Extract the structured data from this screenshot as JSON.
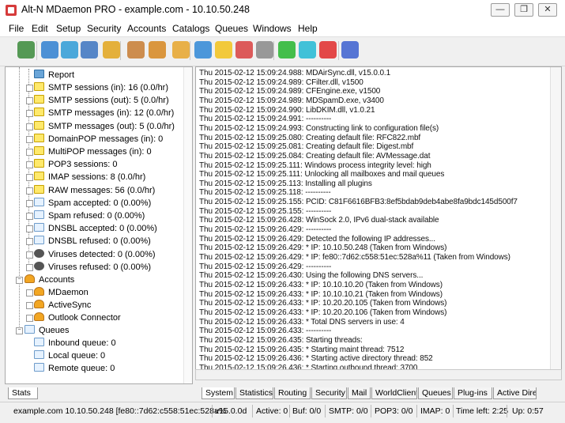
{
  "window": {
    "title": "Alt-N MDaemon PRO - example.com - 10.10.50.248",
    "minimize_glyph": "—",
    "restore_glyph": "❐",
    "close_glyph": "✕"
  },
  "menu": [
    "File",
    "Edit",
    "Setup",
    "Security",
    "Accounts",
    "Catalogs",
    "Queues",
    "Windows",
    "Help"
  ],
  "toolbar": {
    "icons": [
      {
        "name": "green-check-icon",
        "color": "#3a8a3a"
      },
      {
        "name": "globe-icon",
        "color": "#2f7fd0"
      },
      {
        "name": "funnel-icon",
        "color": "#2e9bd6"
      },
      {
        "name": "search-icon",
        "color": "#3b73c0"
      },
      {
        "name": "lock-icon",
        "color": "#e2a51b"
      },
      {
        "name": "user-edit-icon",
        "color": "#c77b31"
      },
      {
        "name": "user-icon",
        "color": "#d6861f"
      },
      {
        "name": "users-icon",
        "color": "#e6a52a"
      },
      {
        "name": "refresh-blue-icon",
        "color": "#2f87d6"
      },
      {
        "name": "refresh-yellow-icon",
        "color": "#f2c21b"
      },
      {
        "name": "refresh-red-icon",
        "color": "#d84040"
      },
      {
        "name": "refresh-grey-icon",
        "color": "#888888"
      },
      {
        "name": "green-light-icon",
        "color": "#26b52e"
      },
      {
        "name": "cyan-light-icon",
        "color": "#22b8d4"
      },
      {
        "name": "red-light-icon",
        "color": "#e02a2a"
      },
      {
        "name": "help-icon",
        "color": "#3b5fcf"
      }
    ]
  },
  "tree": {
    "report_label": "Report",
    "stats": [
      {
        "label": "SMTP sessions (in): 16  (0.0/hr)",
        "icon": "env"
      },
      {
        "label": "SMTP sessions (out): 5  (0.0/hr)",
        "icon": "env"
      },
      {
        "label": "SMTP messages (in): 12  (0.0/hr)",
        "icon": "env"
      },
      {
        "label": "SMTP messages (out): 5  (0.0/hr)",
        "icon": "env"
      },
      {
        "label": "DomainPOP messages (in): 0",
        "icon": "env"
      },
      {
        "label": "MultiPOP messages (in): 0",
        "icon": "env"
      },
      {
        "label": "POP3 sessions: 0",
        "icon": "env"
      },
      {
        "label": "IMAP sessions: 8  (0.0/hr)",
        "icon": "env"
      },
      {
        "label": "RAW messages: 56  (0.0/hr)",
        "icon": "env"
      },
      {
        "label": "Spam accepted: 0  (0.00%)",
        "icon": "env-blue"
      },
      {
        "label": "Spam refused: 0  (0.00%)",
        "icon": "env-blue"
      },
      {
        "label": "DNSBL accepted: 0  (0.00%)",
        "icon": "env-blue"
      },
      {
        "label": "DNSBL refused: 0  (0.00%)",
        "icon": "env-blue"
      },
      {
        "label": "Viruses detected: 0  (0.00%)",
        "icon": "bug"
      },
      {
        "label": "Viruses refused: 0  (0.00%)",
        "icon": "bug"
      }
    ],
    "accounts_label": "Accounts",
    "accounts": [
      "MDaemon",
      "ActiveSync",
      "Outlook Connector"
    ],
    "queues_label": "Queues",
    "queues": [
      "Inbound queue: 0",
      "Local queue: 0",
      "Remote queue: 0"
    ]
  },
  "log": {
    "lines": [
      "Thu 2015-02-12 15:09:24.988: MDAirSync.dll, v15.0.0.1",
      "Thu 2015-02-12 15:09:24.989: CFilter.dll, v1500",
      "Thu 2015-02-12 15:09:24.989: CFEngine.exe, v1500",
      "Thu 2015-02-12 15:09:24.989: MDSpamD.exe, v3400",
      "Thu 2015-02-12 15:09:24.990: LibDKIM.dll, v1.0.21",
      "Thu 2015-02-12 15:09:24.991: ----------",
      "Thu 2015-02-12 15:09:24.993: Constructing link to configuration file(s)",
      "Thu 2015-02-12 15:09:25.080: Creating default file: RFC822.mbf",
      "Thu 2015-02-12 15:09:25.081: Creating default file: Digest.mbf",
      "Thu 2015-02-12 15:09:25.084: Creating default file: AVMessage.dat",
      "Thu 2015-02-12 15:09:25.111: Windows process integrity level: high",
      "Thu 2015-02-12 15:09:25.111: Unlocking all mailboxes and mail queues",
      "Thu 2015-02-12 15:09:25.113: Installing all plugins",
      "Thu 2015-02-12 15:09:25.118: ----------",
      "Thu 2015-02-12 15:09:25.155: PCID: C81F6616BFB3:8ef5bdab9deb4abe8fa9bdc145d500f7",
      "Thu 2015-02-12 15:09:25.155: ----------",
      "Thu 2015-02-12 15:09:26.428: WinSock 2.0, IPv6 dual-stack available",
      "Thu 2015-02-12 15:09:26.429: ----------",
      "Thu 2015-02-12 15:09:26.429: Detected the following IP addresses...",
      "Thu 2015-02-12 15:09:26.429: *  IP:  10.10.50.248  (Taken from Windows)",
      "Thu 2015-02-12 15:09:26.429: *  IP:  fe80::7d62:c558:51ec:528a%11  (Taken from Windows)",
      "Thu 2015-02-12 15:09:26.429: ----------",
      "Thu 2015-02-12 15:09:26.430: Using the following DNS servers...",
      "Thu 2015-02-12 15:09:26.433: *  IP:  10.10.10.20  (Taken from Windows)",
      "Thu 2015-02-12 15:09:26.433: *  IP:  10.10.10.21  (Taken from Windows)",
      "Thu 2015-02-12 15:09:26.433: *  IP:  10.20.20.105  (Taken from Windows)",
      "Thu 2015-02-12 15:09:26.433: *  IP:  10.20.20.106  (Taken from Windows)",
      "Thu 2015-02-12 15:09:26.433: *  Total DNS servers in use: 4",
      "Thu 2015-02-12 15:09:26.433: ----------",
      "Thu 2015-02-12 15:09:26.435: Starting threads:",
      "Thu 2015-02-12 15:09:26.435: *  Starting maint thread: 7512",
      "Thu 2015-02-12 15:09:26.436: *  Starting active directory thread: 852",
      "Thu 2015-02-12 15:09:26.436: *  Starting outbound thread: 3700"
    ]
  },
  "tabs": {
    "left": "Stats",
    "right": [
      "System",
      "Statistics",
      "Routing",
      "Security",
      "Mail",
      "WorldClient",
      "Queues",
      "Plug-ins",
      "Active Dire"
    ],
    "active_right": "System"
  },
  "status": {
    "host": "example.com  10.10.50.248  [fe80::7d62:c558:51ec:528a%",
    "version": "v15.0.0d",
    "active": "Active: 0",
    "buf": "Buf: 0/0",
    "smtp": "SMTP: 0/0",
    "pop3": "POP3: 0/0",
    "imap": "IMAP: 0",
    "time_left": "Time left: 2:25",
    "up": "Up: 0:57"
  }
}
